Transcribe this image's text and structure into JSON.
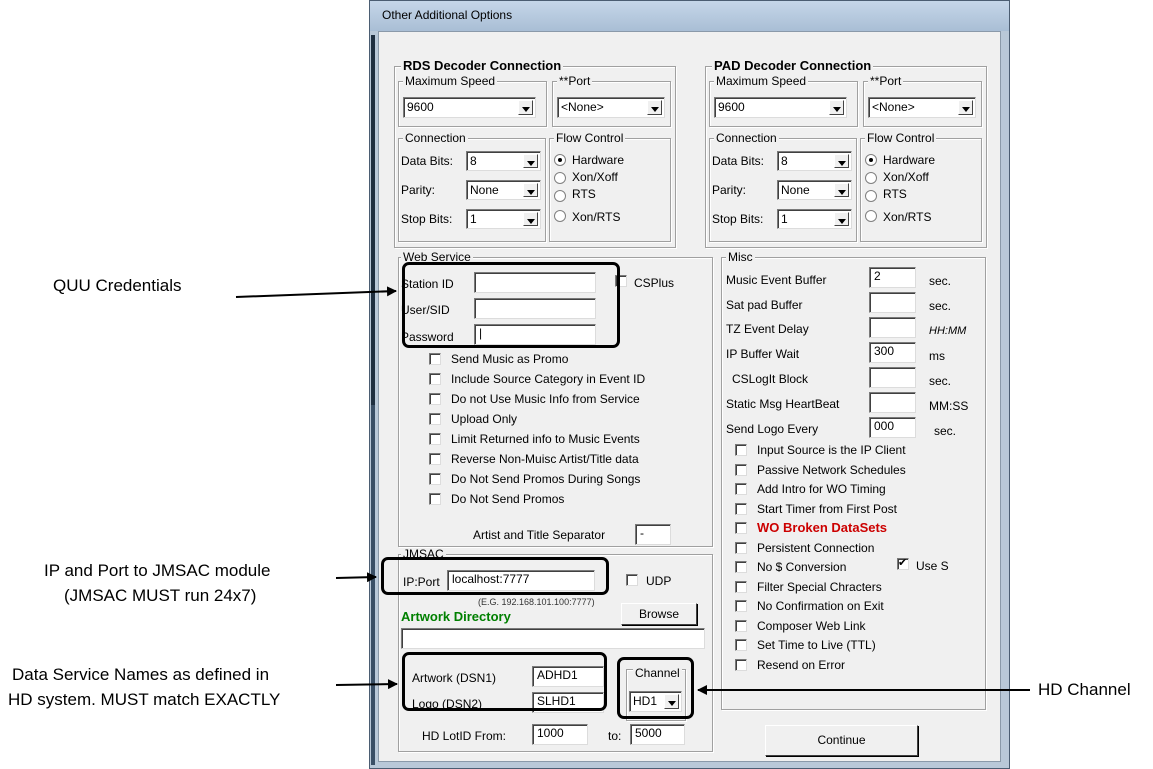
{
  "window": {
    "title": "Other Additional Options"
  },
  "rds": {
    "title": "RDS Decoder Connection",
    "max_speed_label": "Maximum Speed",
    "max_speed_value": "9600",
    "port_label": "**Port",
    "port_value": "<None>",
    "connection_label": "Connection",
    "data_bits_label": "Data Bits:",
    "data_bits_value": "8",
    "parity_label": "Parity:",
    "parity_value": "None",
    "stop_bits_label": "Stop Bits:",
    "stop_bits_value": "1",
    "flow_label": "Flow Control",
    "flow_options": [
      "Hardware",
      "Xon/Xoff",
      "RTS",
      "Xon/RTS"
    ],
    "flow_selected": "Hardware"
  },
  "pad": {
    "title": "PAD Decoder Connection",
    "max_speed_label": "Maximum Speed",
    "max_speed_value": "9600",
    "port_label": "**Port",
    "port_value": "<None>",
    "connection_label": "Connection",
    "data_bits_label": "Data Bits:",
    "data_bits_value": "8",
    "parity_label": "Parity:",
    "parity_value": "None",
    "stop_bits_label": "Stop Bits:",
    "stop_bits_value": "1",
    "flow_label": "Flow Control",
    "flow_options": [
      "Hardware",
      "Xon/Xoff",
      "RTS",
      "Xon/RTS"
    ],
    "flow_selected": "Hardware"
  },
  "web_service": {
    "title": "Web Service",
    "station_id_label": "Station ID",
    "station_id_value": "",
    "csplus_label": "CSPlus",
    "user_sid_label": "User/SID",
    "user_sid_value": "",
    "password_label": "Password",
    "password_value": "|",
    "options": [
      "Send Music as Promo",
      "Include Source Category in Event ID",
      "Do not Use Music Info from Service",
      "Upload Only",
      "Limit Returned info to Music Events",
      "Reverse Non-Muisc Artist/Title data",
      "Do Not Send Promos During Songs",
      "Do Not Send Promos"
    ],
    "separator_label": "Artist and Title Separator",
    "separator_value": "-"
  },
  "misc": {
    "title": "Misc",
    "fields": [
      {
        "label": "Music Event Buffer",
        "value": "2",
        "unit": "sec."
      },
      {
        "label": "Sat pad  Buffer",
        "value": "",
        "unit": "sec."
      },
      {
        "label": "TZ Event Delay",
        "value": "",
        "unit": "HH:MM"
      },
      {
        "label": "IP Buffer Wait",
        "value": "300",
        "unit": "ms"
      },
      {
        "label": "CSLogIt Block",
        "value": "",
        "unit": "sec."
      },
      {
        "label": "Static Msg HeartBeat",
        "value": "",
        "unit": "MM:SS"
      },
      {
        "label": "Send Logo Every",
        "value": "000",
        "unit": "sec."
      }
    ],
    "options": [
      "Input Source is the IP Client",
      "Passive Network Schedules",
      "Add Intro for WO Timing",
      "Start Timer from First Post",
      "WO Broken DataSets",
      "Persistent Connection",
      "No $ Conversion",
      "Filter Special Chracters",
      "No Confirmation on Exit",
      "Composer Web Link",
      "Set Time to Live (TTL)",
      "Resend on Error"
    ],
    "use_s_label": "Use S",
    "broken_color": "#cc0000"
  },
  "jmsac": {
    "title": "JMSAC",
    "ip_port_label": "IP:Port",
    "ip_port_value": "localhost:7777",
    "udp_label": "UDP",
    "example_text": "(E.G. 192.168.101.100:7777)",
    "artwork_dir_label": "Artwork Directory",
    "artwork_dir_color": "#008000",
    "browse_label": "Browse",
    "artwork_dir_value": "",
    "artwork_dsn_label": "Artwork (DSN1)",
    "artwork_dsn_value": "ADHD1",
    "logo_dsn_label": "Logo (DSN2)",
    "logo_dsn_value": "SLHD1",
    "channel_label": "Channel",
    "channel_value": "HD1",
    "lotid_label": "HD LotID  From:",
    "lotid_from": "1000",
    "lotid_to_label": "to:",
    "lotid_to": "5000"
  },
  "continue_label": "Continue",
  "annotations": {
    "quu": "QUU Credentials",
    "ip_line1": "IP and Port to JMSAC module",
    "ip_line2": "(JMSAC MUST run 24x7)",
    "dsn_line1": "Data Service Names as defined in",
    "dsn_line2": "HD system. MUST match EXACTLY",
    "hd_channel": "HD Channel"
  }
}
